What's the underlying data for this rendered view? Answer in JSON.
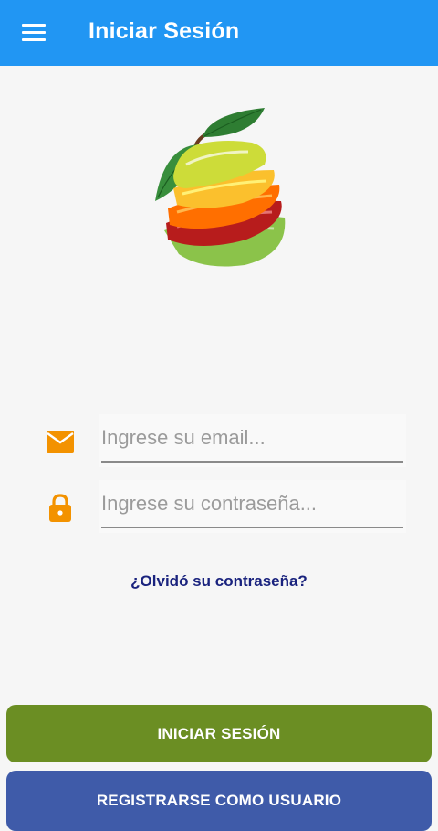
{
  "app_bar": {
    "title": "Iniciar Sesión",
    "color": "#2196f3"
  },
  "logo": {
    "icon": "fruit-slices-logo"
  },
  "email_field": {
    "icon": "envelope-icon",
    "placeholder": "Ingrese su email...",
    "value": ""
  },
  "password_field": {
    "icon": "lock-icon",
    "placeholder": "Ingrese su contraseña...",
    "value": ""
  },
  "forgot_password": {
    "label": "¿Olvidó su contraseña?"
  },
  "buttons": {
    "login_label": "INICIAR SESIÓN",
    "login_color": "#6b8e23",
    "register_label": "REGISTRARSE COMO USUARIO",
    "register_color": "#3f5ba9"
  },
  "accent_color": "#f39200"
}
